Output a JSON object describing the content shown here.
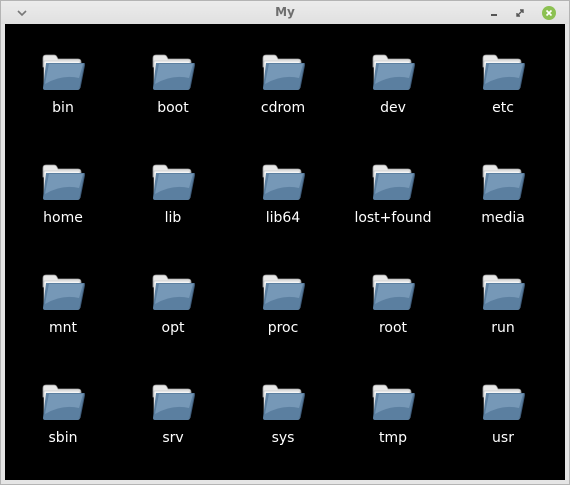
{
  "window": {
    "title": "My"
  },
  "colors": {
    "background": "#000000",
    "label": "#ffffff",
    "close": "#8cc152",
    "folder": "#5b7fa0"
  },
  "icons": {
    "menu": "chevron-down-icon",
    "minimize": "minimize-icon",
    "maximize": "maximize-icon",
    "close": "close-icon",
    "item": "folder-icon"
  },
  "items": [
    {
      "label": "bin"
    },
    {
      "label": "boot"
    },
    {
      "label": "cdrom"
    },
    {
      "label": "dev"
    },
    {
      "label": "etc"
    },
    {
      "label": "home"
    },
    {
      "label": "lib"
    },
    {
      "label": "lib64"
    },
    {
      "label": "lost+found"
    },
    {
      "label": "media"
    },
    {
      "label": "mnt"
    },
    {
      "label": "opt"
    },
    {
      "label": "proc"
    },
    {
      "label": "root"
    },
    {
      "label": "run"
    },
    {
      "label": "sbin"
    },
    {
      "label": "srv"
    },
    {
      "label": "sys"
    },
    {
      "label": "tmp"
    },
    {
      "label": "usr"
    }
  ]
}
